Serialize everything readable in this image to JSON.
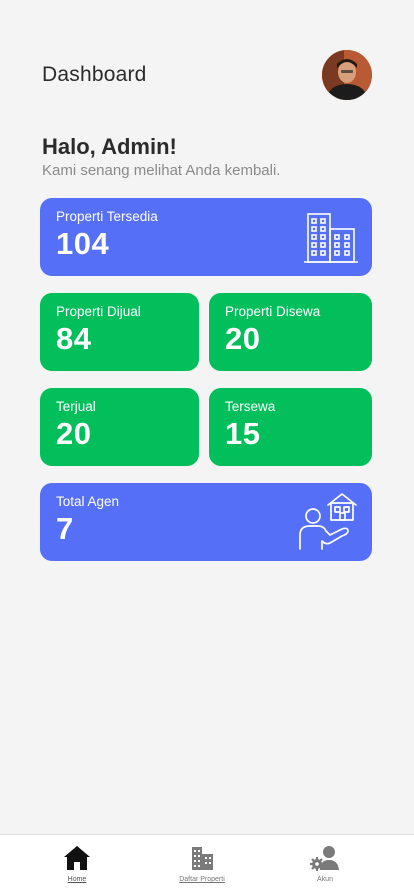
{
  "header": {
    "title": "Dashboard"
  },
  "greeting": {
    "title": "Halo, Admin!",
    "subtitle": "Kami senang melihat Anda kembali."
  },
  "cards": [
    {
      "label": "Properti Tersedia",
      "value": "104",
      "color": "#5570f7",
      "icon": "buildings-icon"
    },
    {
      "label": "Properti Dijual",
      "value": "84",
      "color": "#02bf5c"
    },
    {
      "label": "Properti Disewa",
      "value": "20",
      "color": "#02bf5c"
    },
    {
      "label": "Terjual",
      "value": "20",
      "color": "#02bf5c"
    },
    {
      "label": "Tersewa",
      "value": "15",
      "color": "#02bf5c"
    },
    {
      "label": "Total Agen",
      "value": "7",
      "color": "#5570f7",
      "icon": "agent-house-icon"
    }
  ],
  "nav": {
    "items": [
      {
        "label": "Home",
        "icon": "home-icon",
        "active": true
      },
      {
        "label": "Daftar Properti",
        "icon": "buildings-icon",
        "active": false
      },
      {
        "label": "Akun",
        "icon": "user-settings-icon",
        "active": false
      }
    ]
  }
}
